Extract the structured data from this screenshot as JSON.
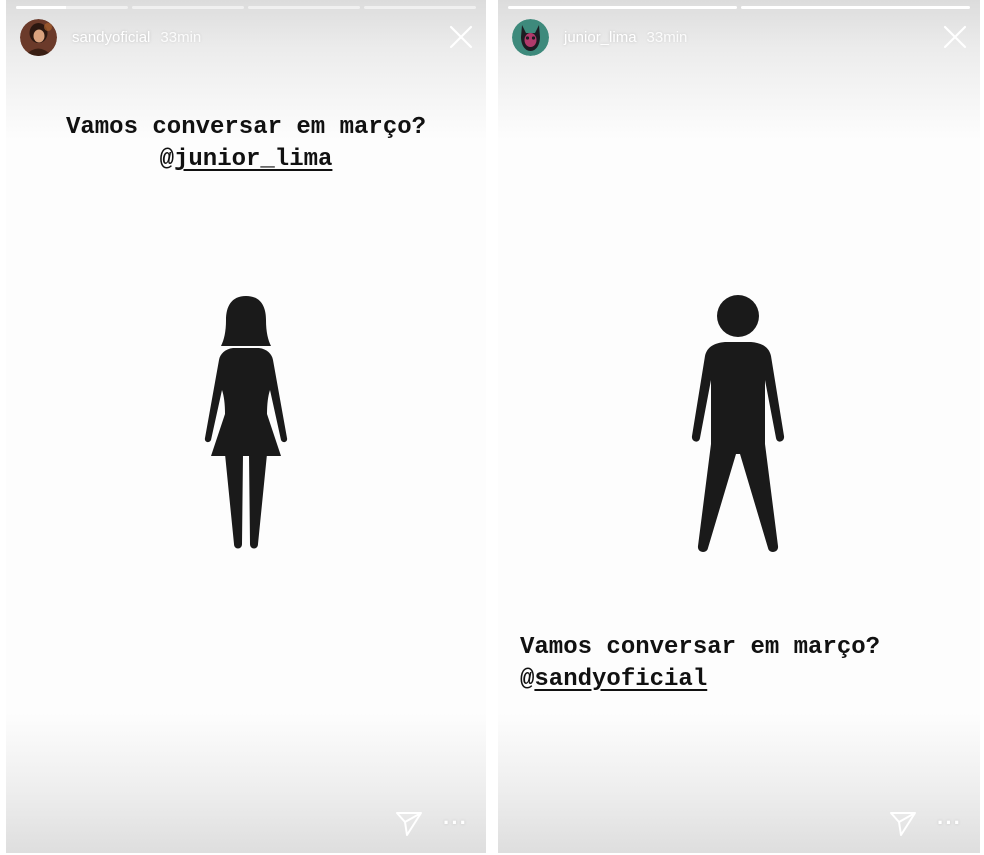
{
  "stories": [
    {
      "username": "sandyoficial",
      "time": "33min",
      "caption_text": "Vamos conversar em março?",
      "mention_prefix": "@",
      "mention": "junior_lima",
      "figure": "woman-silhouette-icon",
      "progress": [
        0.45,
        0.0,
        0.0,
        0.0
      ]
    },
    {
      "username": "junior_lima",
      "time": "33min",
      "caption_text": "Vamos conversar em março?",
      "mention_prefix": "@",
      "mention": "sandyoficial",
      "figure": "man-silhouette-icon",
      "progress": [
        1.0,
        1.0
      ]
    }
  ],
  "icons": {
    "close": "close-icon",
    "send": "send-icon",
    "more": "more-options-icon",
    "more_glyph": "···"
  },
  "colors": {
    "header_text": "#ffffff",
    "caption_text": "#111111",
    "figure_fill": "#1a1a1a",
    "story_background": "#fdfdfd"
  }
}
